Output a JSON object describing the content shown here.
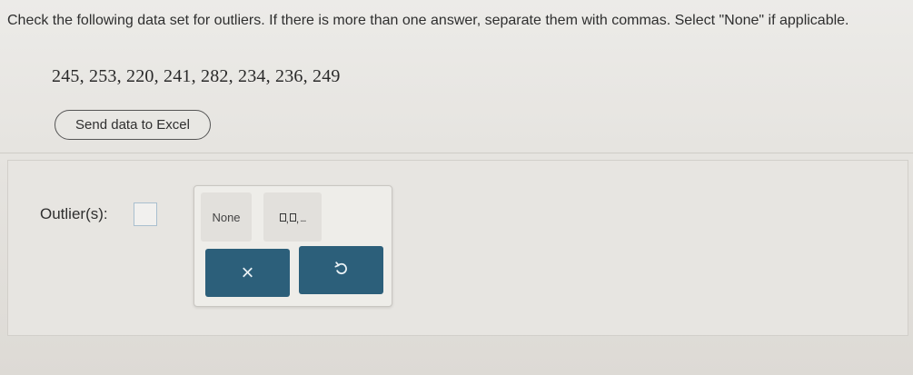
{
  "question": {
    "text": "Check the following data set for outliers. If there is more than one answer, separate them with commas. Select \"None\" if applicable."
  },
  "dataset": {
    "values": "245, 253, 220, 241, 282, 234, 236, 249"
  },
  "excel_button": {
    "label": "Send data to Excel"
  },
  "answer": {
    "label": "Outlier(s):",
    "value": ""
  },
  "keypad": {
    "none_label": "None",
    "list_label": "□,□,...",
    "clear_label": "×",
    "clear_icon": "x-icon",
    "undo_icon": "undo-icon"
  },
  "colors": {
    "accent": "#2c5f7a",
    "background": "#e8e6e2",
    "input_border": "#a9bfcf"
  }
}
